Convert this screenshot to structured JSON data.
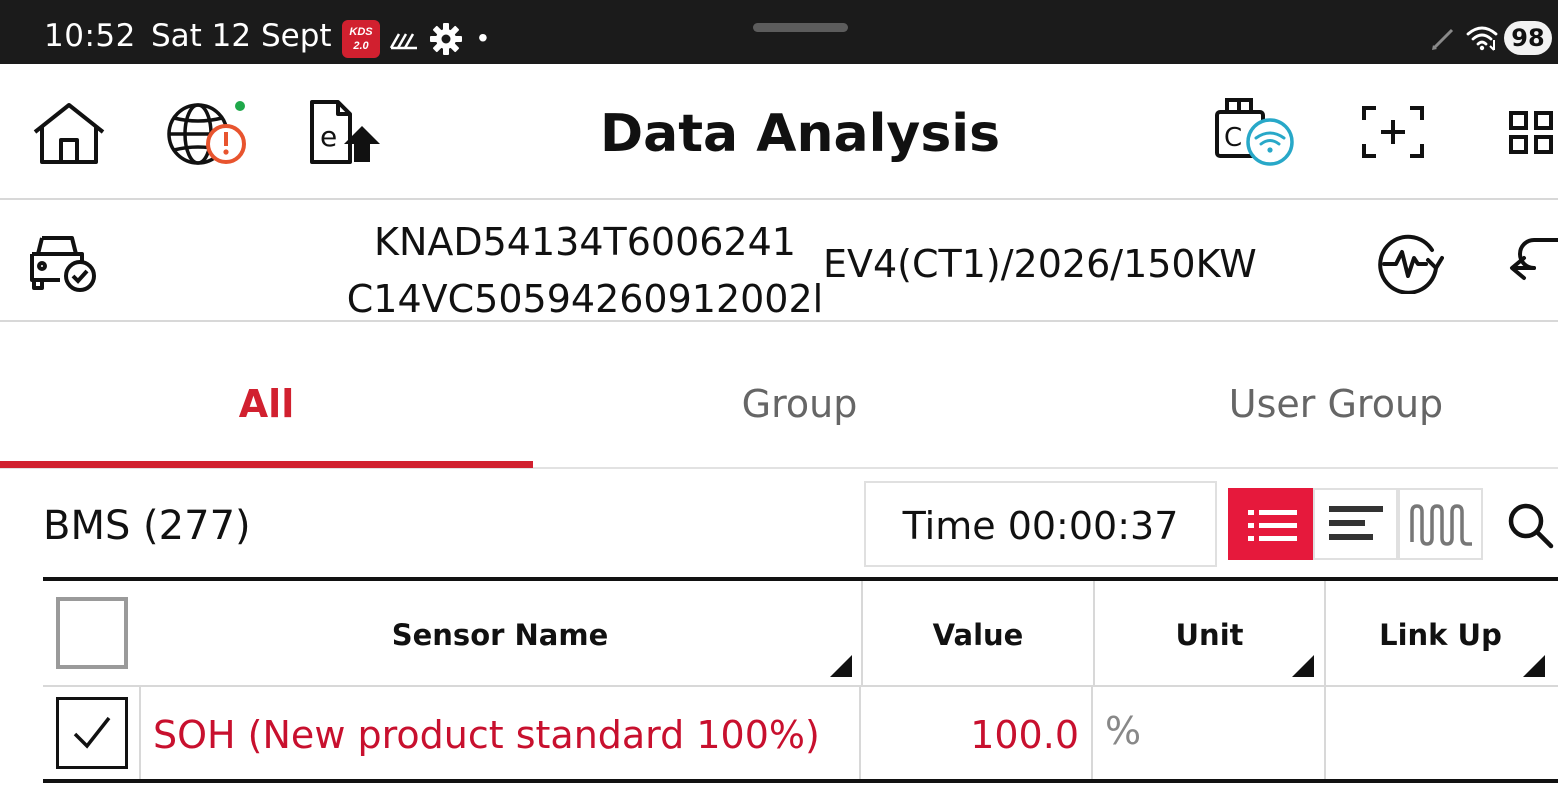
{
  "status_bar": {
    "time": "10:52",
    "date": "Sat 12 Sept",
    "app_badge_line1": "KDS",
    "app_badge_line2": "2.0",
    "dot": "•",
    "battery": "98"
  },
  "toolbar": {
    "title": "Data Analysis",
    "icons": [
      "home-icon",
      "web-alert-icon",
      "upload-document-icon",
      "vci-wifi-icon",
      "screen-capture-icon",
      "grid-menu-icon"
    ],
    "accent_dot_color": "#1fa84a",
    "alert_color": "#e8542e",
    "wifi_color": "#28a8c8"
  },
  "vehicle": {
    "vin_line1": "KNAD54134T6006241",
    "vin_line2": "C14VC5059426091200​2l",
    "model": "EV4(CT1)/2026/150KW"
  },
  "tabs": [
    {
      "label": "All",
      "active": true
    },
    {
      "label": "Group",
      "active": false
    },
    {
      "label": "User Group",
      "active": false
    }
  ],
  "list": {
    "title": "BMS (277)",
    "time_display": "Time 00:00:37",
    "view_modes": [
      "list-view",
      "bar-view",
      "graph-view"
    ],
    "active_view": "list-view"
  },
  "table": {
    "headers": {
      "sensor_name": "Sensor Name",
      "value": "Value",
      "unit": "Unit",
      "link_up": "Link Up"
    },
    "rows": [
      {
        "checked": true,
        "sensor_name": "SOH (New product standard 100%)",
        "value": "100.0",
        "unit": "%",
        "link_up": ""
      }
    ]
  },
  "colors": {
    "accent": "#d1202f",
    "active_view_bg": "#e6193c",
    "status_bar_bg": "#1b1b1b"
  }
}
